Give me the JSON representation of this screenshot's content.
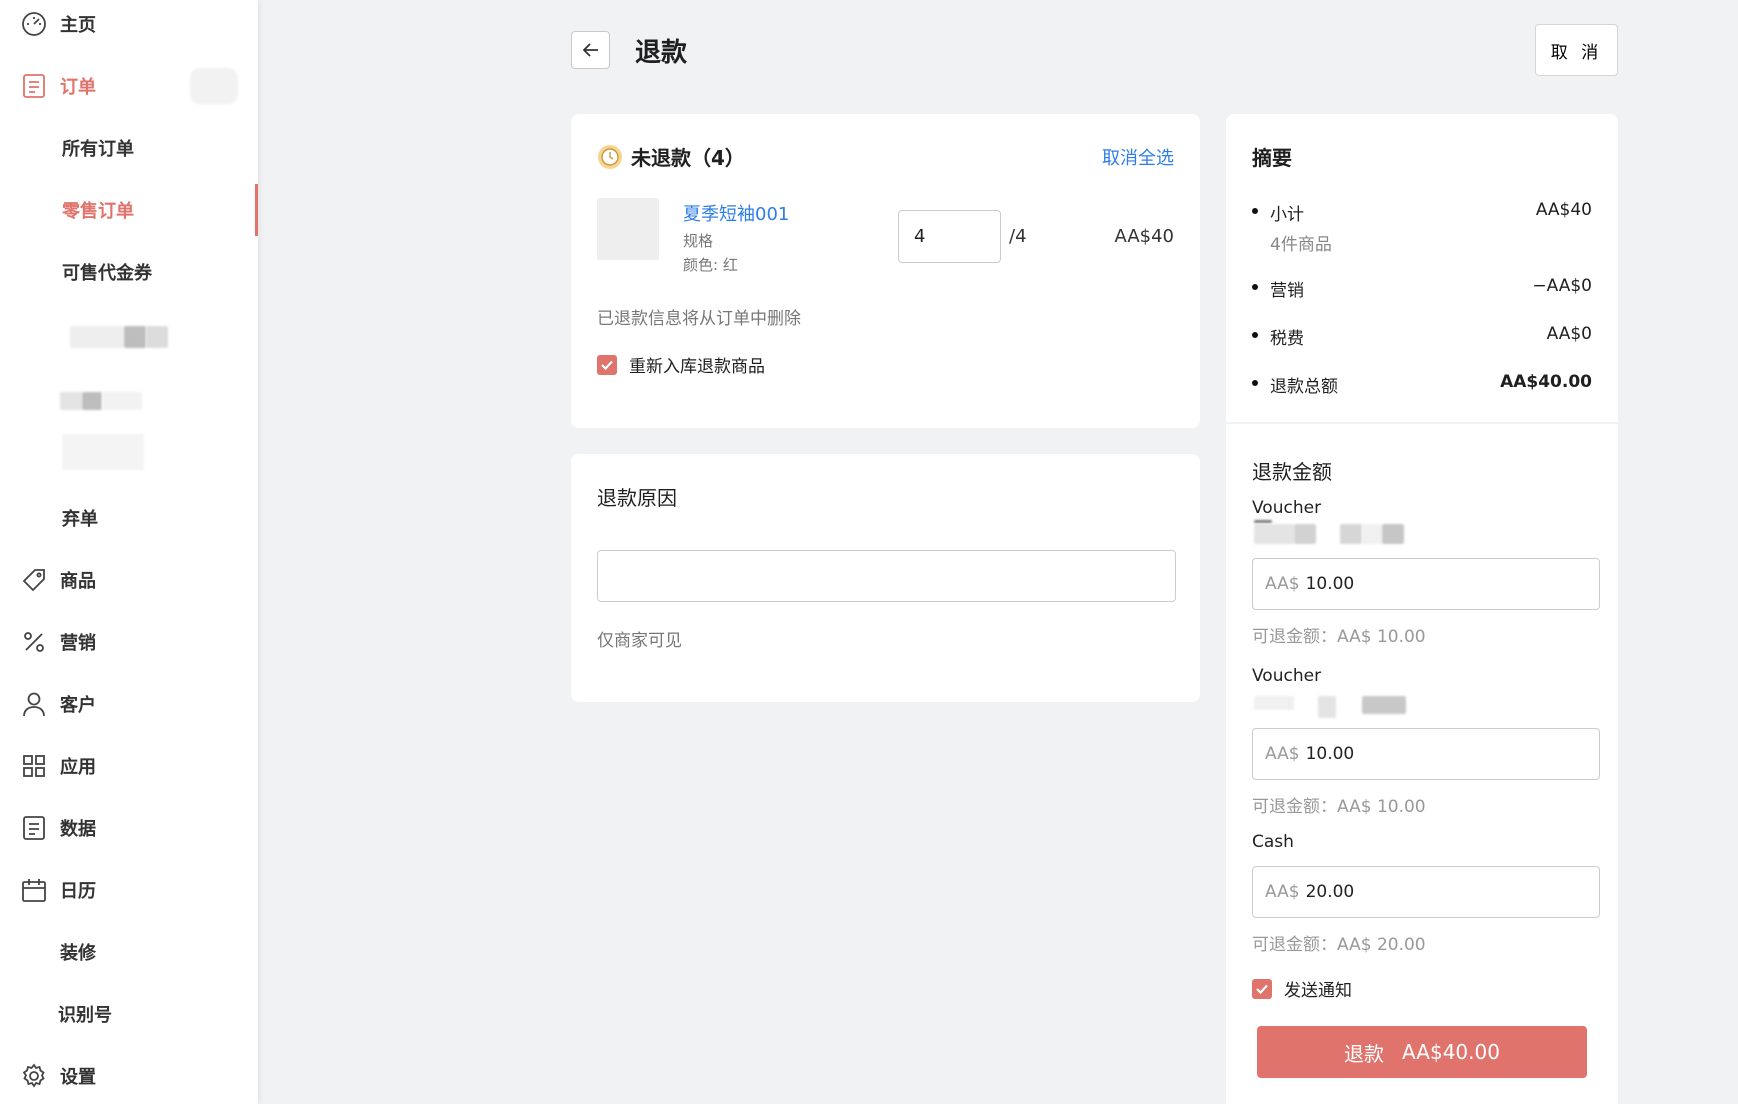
{
  "sidebar": {
    "home": "主页",
    "orders": "订单",
    "all_orders": "所有订单",
    "retail_orders": "零售订单",
    "vouchers": "可售代金券",
    "abandoned": "弃单",
    "products": "商品",
    "marketing": "营销",
    "customers": "客户",
    "apps": "应用",
    "data": "数据",
    "calendar": "日历",
    "decorate": "装修",
    "id_number": "识别号",
    "settings": "设置"
  },
  "header": {
    "title": "退款",
    "cancel_label": "取 消"
  },
  "unrefunded": {
    "title": "未退款（4）",
    "deselect_all": "取消全选",
    "product": {
      "name": "夏季短袖001",
      "spec": "规格",
      "color": "颜色: 红",
      "qty": "4",
      "qty_total": "/4",
      "price": "AA$40"
    },
    "note": "已退款信息将从订单中删除",
    "restock_label": "重新入库退款商品",
    "restock_checked": true
  },
  "reason": {
    "title": "退款原因",
    "value": "",
    "hint": "仅商家可见"
  },
  "summary": {
    "title": "摘要",
    "subtotal_label": "小计",
    "subtotal_value": "AA$40",
    "subtotal_items": "4件商品",
    "marketing_label": "营销",
    "marketing_value": "−AA$0",
    "tax_label": "税费",
    "tax_value": "AA$0",
    "total_label": "退款总额",
    "total_value": "AA$40.00"
  },
  "refund_amount": {
    "title": "退款金额",
    "methods": [
      {
        "label": "Voucher",
        "currency": "AA$",
        "amount": "10.00",
        "available": "可退金额：AA$ 10.00"
      },
      {
        "label": "Voucher",
        "currency": "AA$",
        "amount": "10.00",
        "available": "可退金额：AA$ 10.00"
      },
      {
        "label": "Cash",
        "currency": "AA$",
        "amount": "20.00",
        "available": "可退金额：AA$ 20.00"
      }
    ],
    "notify_label": "发送通知",
    "notify_checked": true,
    "refund_button_label": "退款",
    "refund_button_amount": "AA$40.00"
  },
  "colors": {
    "accent": "#e0736b",
    "link": "#2f7ee6"
  },
  "icons": [
    "dashboard-icon",
    "order-icon",
    "tag-icon",
    "percent-icon",
    "user-icon",
    "grid-icon",
    "data-icon",
    "calendar-icon",
    "gear-icon",
    "arrow-left-icon",
    "clock-icon",
    "check-icon"
  ]
}
